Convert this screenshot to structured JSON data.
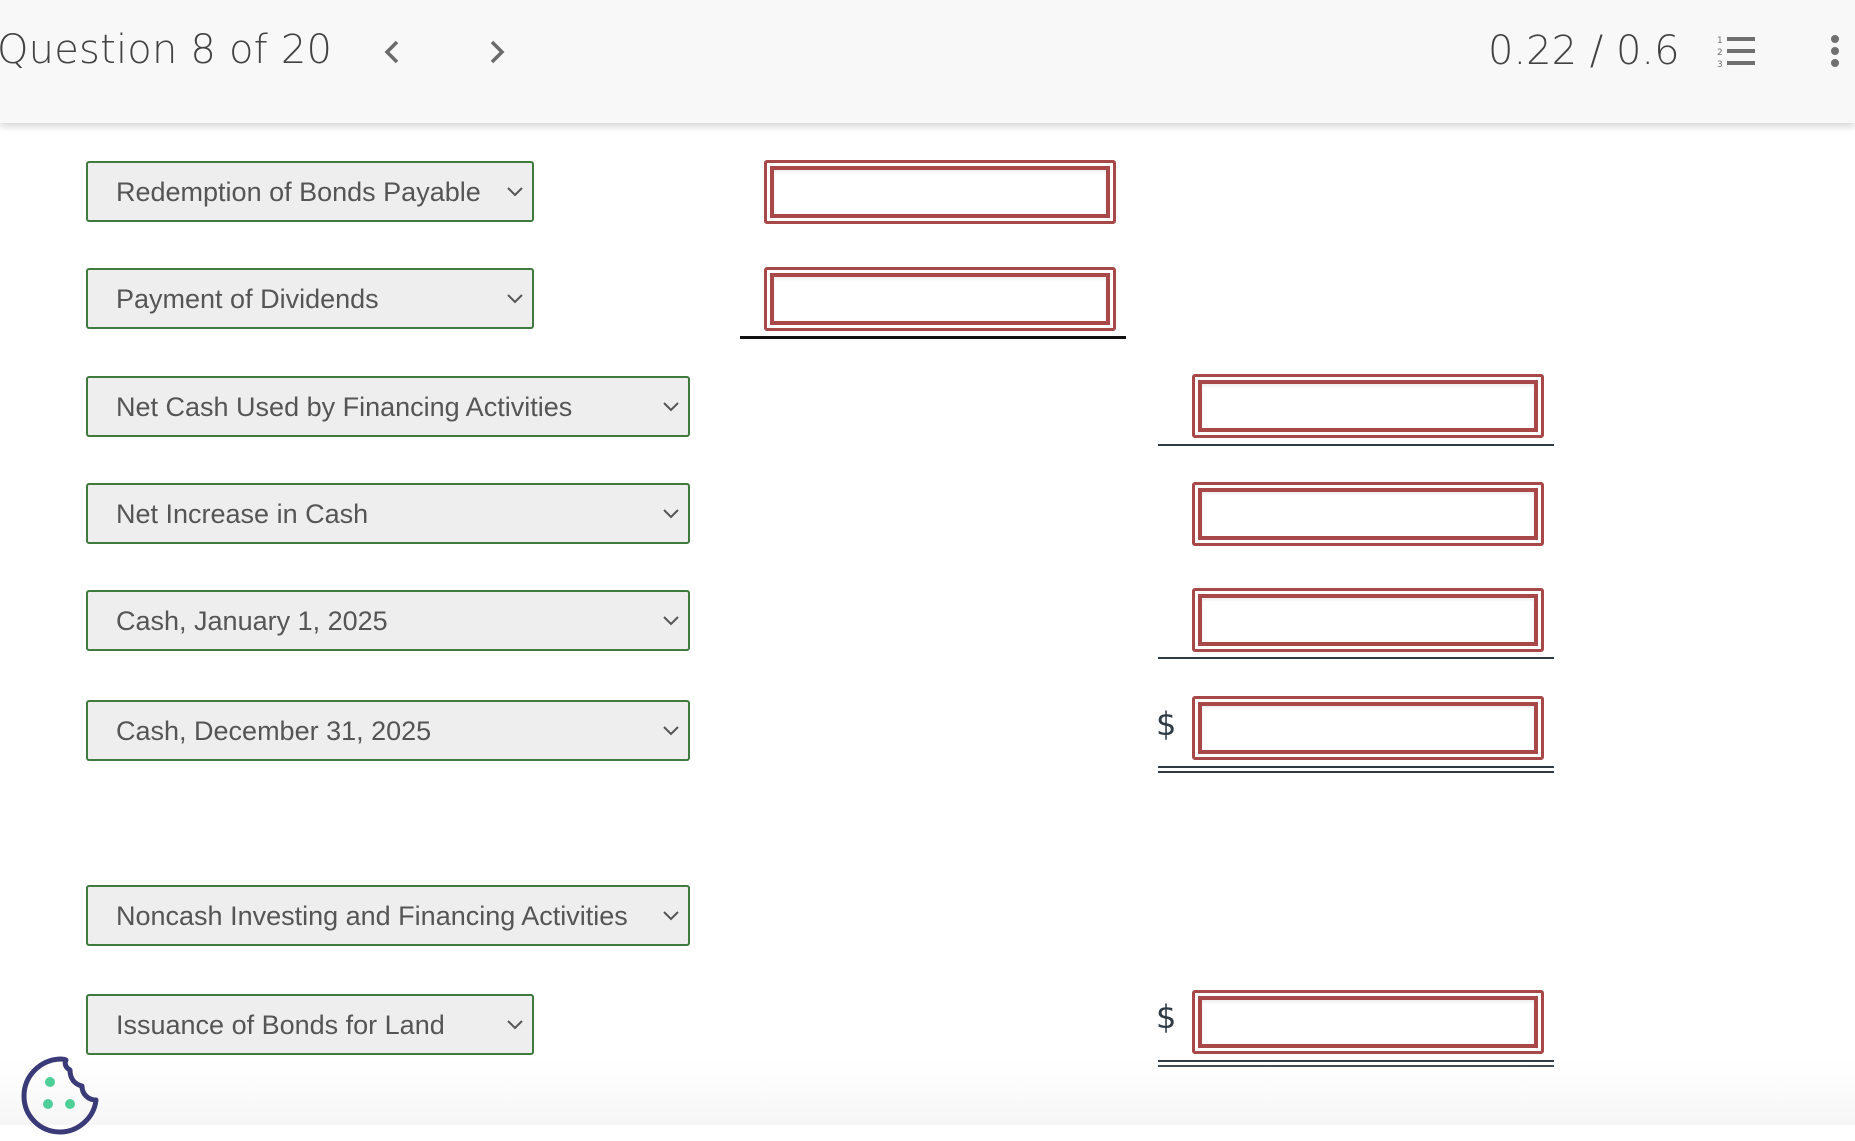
{
  "header": {
    "question_label": "Question 8 of 20",
    "score": "0.22 / 0.6",
    "icons": {
      "prev": "chevron-left-icon",
      "next": "chevron-right-icon",
      "list": "numbered-list-icon",
      "more": "kebab-menu-icon"
    }
  },
  "rows": [
    {
      "label": "Redemption of Bonds Payable",
      "column": "middle",
      "value": ""
    },
    {
      "label": "Payment of Dividends",
      "column": "middle",
      "value": ""
    },
    {
      "label": "Net Cash Used by Financing Activities",
      "column": "right",
      "value": ""
    },
    {
      "label": "Net Increase in Cash",
      "column": "right",
      "value": ""
    },
    {
      "label": "Cash, January 1, 2025",
      "column": "right",
      "value": ""
    },
    {
      "label": "Cash, December 31, 2025",
      "column": "right",
      "value": "",
      "prefix": "$"
    },
    {
      "label": "Noncash Investing and Financing Activities"
    },
    {
      "label": "Issuance of Bonds for Land",
      "column": "right",
      "value": "",
      "prefix": "$"
    }
  ],
  "colors": {
    "select_border": "#3f7a3f",
    "input_border": "#a84848",
    "cookie_outline": "#3a3a78",
    "cookie_dots": "#4fcf98"
  },
  "cookie": {
    "icon": "cookie-icon"
  }
}
